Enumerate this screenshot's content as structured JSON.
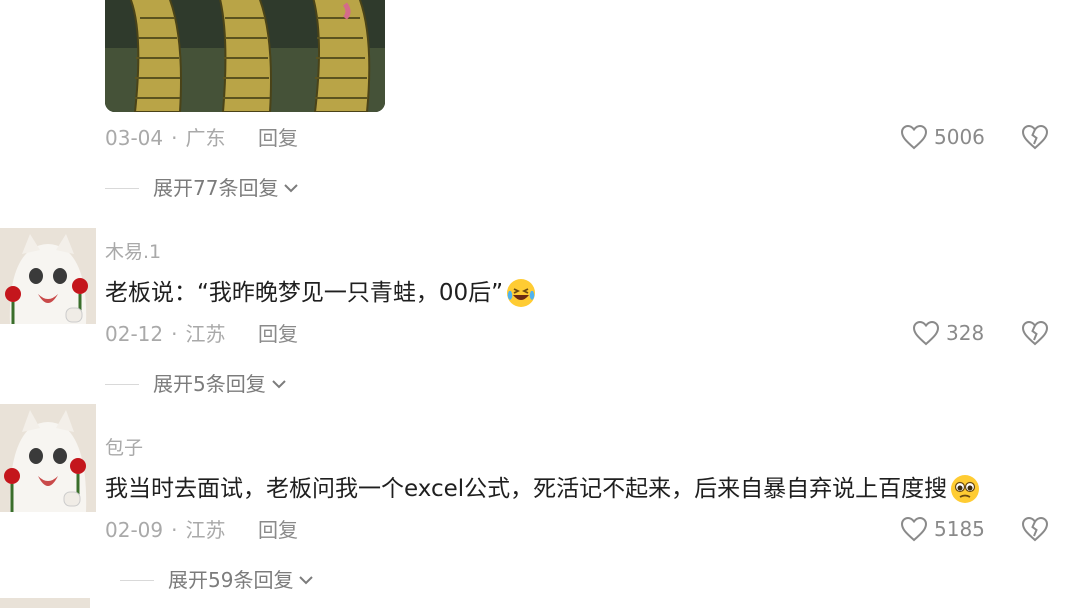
{
  "comments": [
    {
      "date": "03-04",
      "location": "广东",
      "reply_label": "回复",
      "likes": "5006",
      "expand_label": "展开77条回复"
    },
    {
      "username": "木易.1",
      "text": "老板说：“我昨晚梦见一只青蛙，00后”",
      "emoji": "laughing-tears-emoji",
      "date": "02-12",
      "location": "江苏",
      "reply_label": "回复",
      "likes": "328",
      "expand_label": "展开5条回复"
    },
    {
      "username": "包子",
      "text": "我当时去面试，老板问我一个excel公式，死活记不起来，后来自暴自弃说上百度搜",
      "emoji": "pleading-emoji",
      "date": "02-09",
      "location": "江苏",
      "reply_label": "回复",
      "likes": "5185",
      "expand_label": "展开59条回复"
    }
  ],
  "meta_separator": "·",
  "icons": {
    "like": "heart-outline-icon",
    "dislike": "broken-heart-icon",
    "expand": "chevron-down-icon"
  },
  "colors": {
    "meta_gray": "#a9a9a9",
    "text_dark": "#1f1f1f"
  }
}
